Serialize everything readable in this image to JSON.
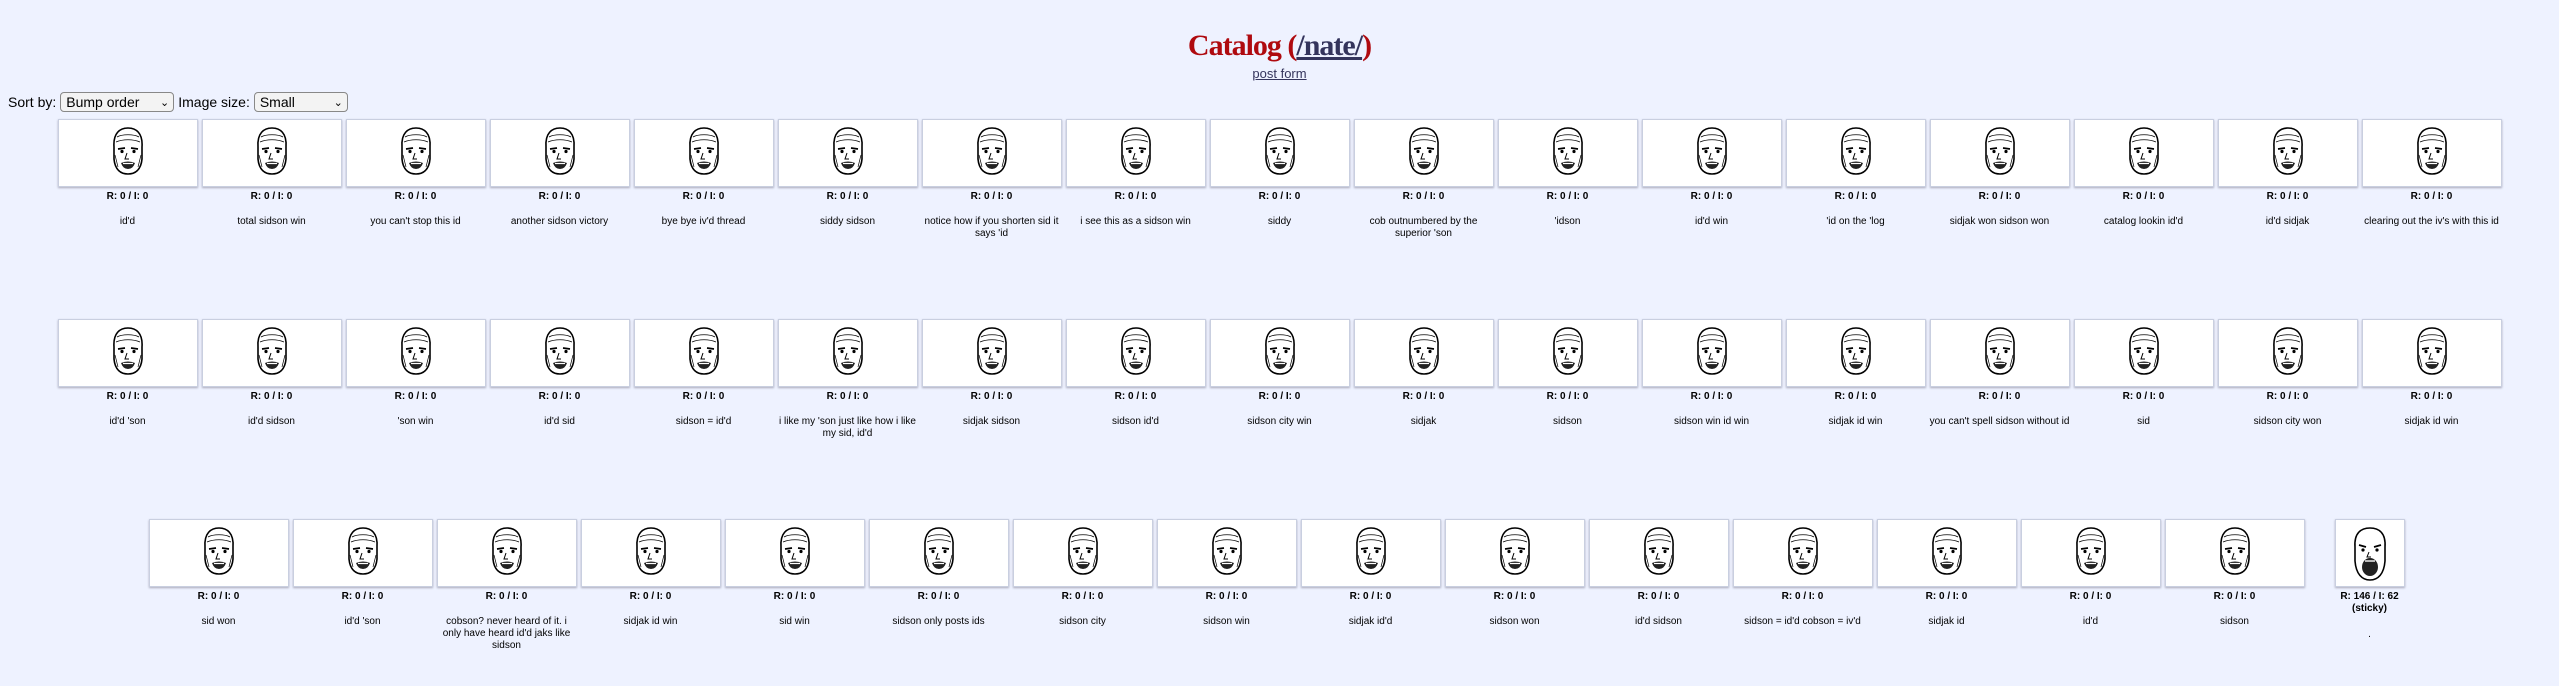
{
  "header": {
    "title_prefix": "Catalog (",
    "board": "/nate/",
    "title_suffix": ")",
    "post_form": "post form"
  },
  "controls": {
    "sort_label": "Sort by:",
    "sort_value": "Bump order",
    "size_label": "Image size:",
    "size_value": "Small"
  },
  "rows": [
    [
      {
        "meta": "R: 0 / I: 0",
        "teaser": "id'd"
      },
      {
        "meta": "R: 0 / I: 0",
        "teaser": "total sidson win"
      },
      {
        "meta": "R: 0 / I: 0",
        "teaser": "you can't stop this id"
      },
      {
        "meta": "R: 0 / I: 0",
        "teaser": "another sidson victory"
      },
      {
        "meta": "R: 0 / I: 0",
        "teaser": "bye bye iv'd thread"
      },
      {
        "meta": "R: 0 / I: 0",
        "teaser": "siddy sidson"
      },
      {
        "meta": "R: 0 / I: 0",
        "teaser": "notice how if you shorten sid it says 'id"
      },
      {
        "meta": "R: 0 / I: 0",
        "teaser": "i see this as a sidson win"
      },
      {
        "meta": "R: 0 / I: 0",
        "teaser": "siddy"
      },
      {
        "meta": "R: 0 / I: 0",
        "teaser": "cob outnumbered by the superior 'son"
      },
      {
        "meta": "R: 0 / I: 0",
        "teaser": "'idson"
      },
      {
        "meta": "R: 0 / I: 0",
        "teaser": "id'd win"
      },
      {
        "meta": "R: 0 / I: 0",
        "teaser": "'id on the 'log"
      },
      {
        "meta": "R: 0 / I: 0",
        "teaser": "sidjak won sidson won"
      },
      {
        "meta": "R: 0 / I: 0",
        "teaser": "catalog lookin id'd"
      },
      {
        "meta": "R: 0 / I: 0",
        "teaser": "id'd sidjak"
      },
      {
        "meta": "R: 0 / I: 0",
        "teaser": "clearing out the iv's with this id"
      }
    ],
    [
      {
        "meta": "R: 0 / I: 0",
        "teaser": "id'd 'son"
      },
      {
        "meta": "R: 0 / I: 0",
        "teaser": "id'd sidson"
      },
      {
        "meta": "R: 0 / I: 0",
        "teaser": "'son win"
      },
      {
        "meta": "R: 0 / I: 0",
        "teaser": "id'd sid"
      },
      {
        "meta": "R: 0 / I: 0",
        "teaser": "sidson = id'd"
      },
      {
        "meta": "R: 0 / I: 0",
        "teaser": "i like my 'son just like how i like my sid, id'd"
      },
      {
        "meta": "R: 0 / I: 0",
        "teaser": "sidjak sidson"
      },
      {
        "meta": "R: 0 / I: 0",
        "teaser": "sidson id'd"
      },
      {
        "meta": "R: 0 / I: 0",
        "teaser": "sidson city win"
      },
      {
        "meta": "R: 0 / I: 0",
        "teaser": "sidjak"
      },
      {
        "meta": "R: 0 / I: 0",
        "teaser": "sidson"
      },
      {
        "meta": "R: 0 / I: 0",
        "teaser": "sidson win id win"
      },
      {
        "meta": "R: 0 / I: 0",
        "teaser": "sidjak id win"
      },
      {
        "meta": "R: 0 / I: 0",
        "teaser": "you can't spell sidson without id"
      },
      {
        "meta": "R: 0 / I: 0",
        "teaser": "sid"
      },
      {
        "meta": "R: 0 / I: 0",
        "teaser": "sidson city won"
      },
      {
        "meta": "R: 0 / I: 0",
        "teaser": "sidjak id win"
      }
    ],
    [
      {
        "meta": "R: 0 / I: 0",
        "teaser": "sid won"
      },
      {
        "meta": "R: 0 / I: 0",
        "teaser": "id'd 'son"
      },
      {
        "meta": "R: 0 / I: 0",
        "teaser": "cobson? never heard of it. i only have heard id'd jaks like sidson"
      },
      {
        "meta": "R: 0 / I: 0",
        "teaser": "sidjak id win"
      },
      {
        "meta": "R: 0 / I: 0",
        "teaser": "sid win"
      },
      {
        "meta": "R: 0 / I: 0",
        "teaser": "sidson only posts ids"
      },
      {
        "meta": "R: 0 / I: 0",
        "teaser": "sidson city"
      },
      {
        "meta": "R: 0 / I: 0",
        "teaser": "sidson win"
      },
      {
        "meta": "R: 0 / I: 0",
        "teaser": "sidjak id'd"
      },
      {
        "meta": "R: 0 / I: 0",
        "teaser": "sidson won"
      },
      {
        "meta": "R: 0 / I: 0",
        "teaser": "id'd sidson"
      },
      {
        "meta": "R: 0 / I: 0",
        "teaser": "sidson = id'd cobson = iv'd"
      },
      {
        "meta": "R: 0 / I: 0",
        "teaser": "sidjak id"
      },
      {
        "meta": "R: 0 / I: 0",
        "teaser": "id'd"
      },
      {
        "meta": "R: 0 / I: 0",
        "teaser": "sidson"
      }
    ]
  ],
  "sticky": {
    "meta": "R: 146 / I: 62 (sticky)",
    "teaser": "."
  },
  "icons": {
    "thread_thumb": "bald-face-icon",
    "sticky_thumb": "screaming-face-icon",
    "select_chevron": "chevron-down-icon"
  }
}
